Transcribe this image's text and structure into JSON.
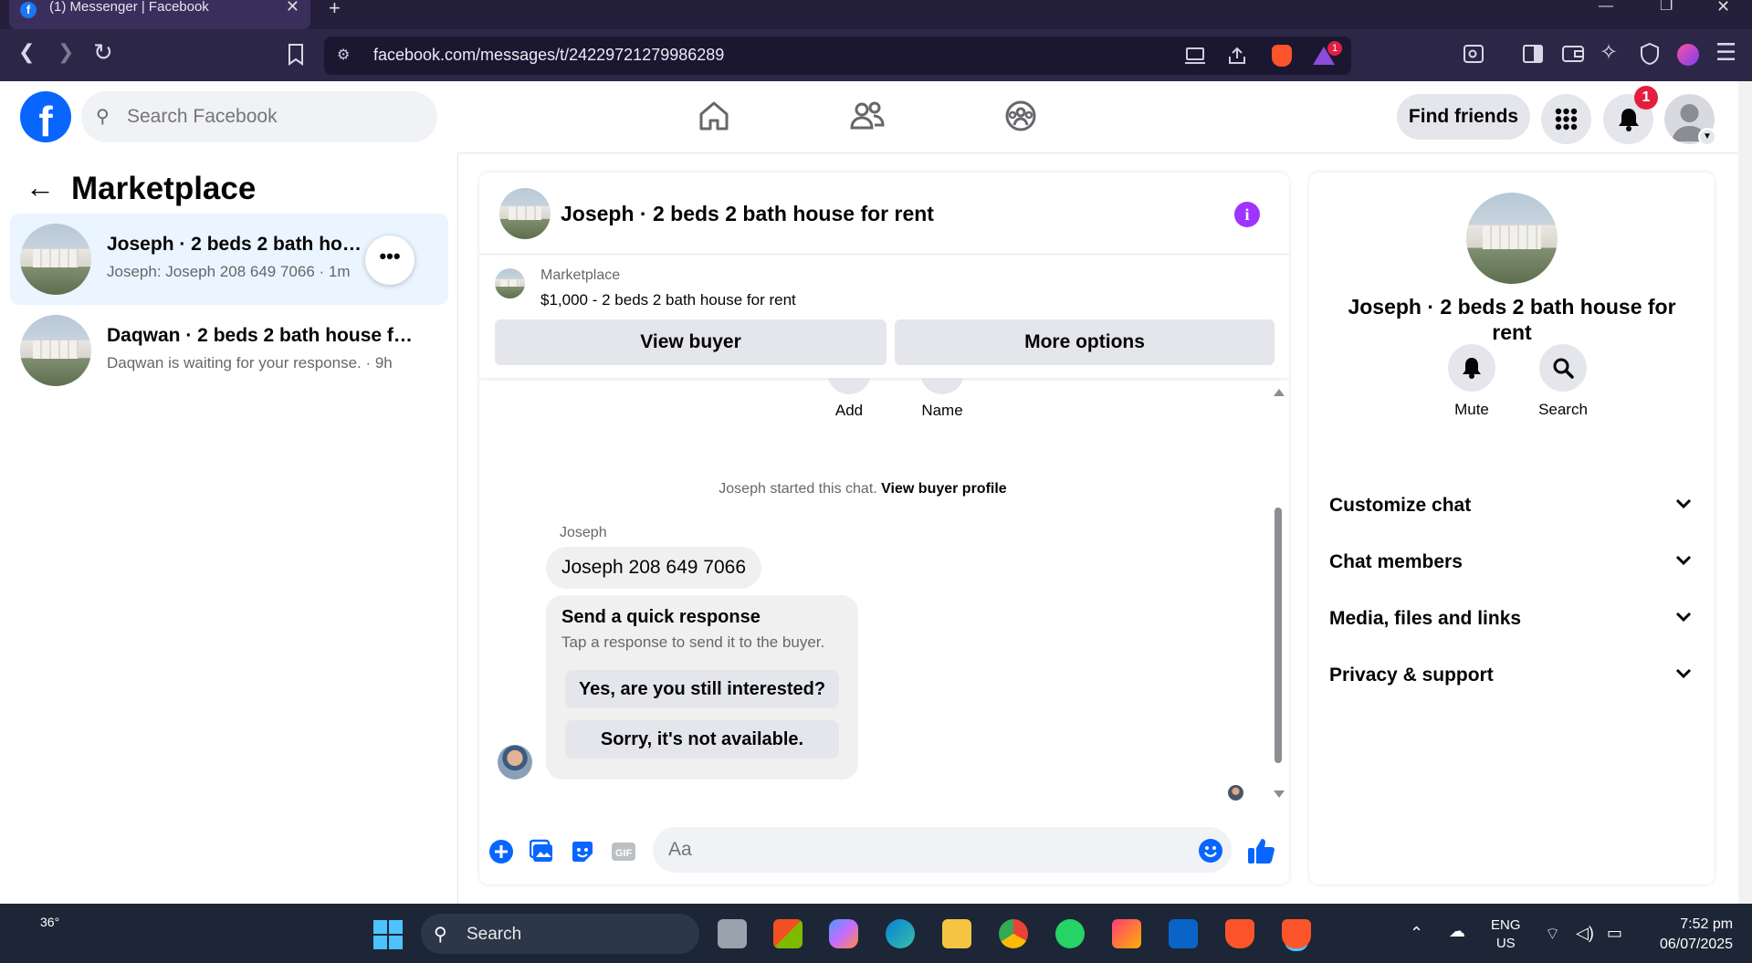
{
  "browser": {
    "tab_title": "(1) Messenger | Facebook",
    "url": "facebook.com/messages/t/24229721279986289",
    "brave_badge": "1"
  },
  "header": {
    "search_placeholder": "Search Facebook",
    "find_friends": "Find friends",
    "notification_count": "1",
    "logo_letter": "f"
  },
  "sidebar": {
    "title": "Marketplace",
    "conversations": [
      {
        "name": "Joseph · 2 beds 2 bath house for rent",
        "preview": "Joseph: Joseph 208 649 7066 · 1m"
      },
      {
        "name": "Daqwan · 2 beds 2 bath house for rent",
        "preview": "Daqwan is waiting for your response. · 9h"
      }
    ],
    "more_label": "•••"
  },
  "chat": {
    "title": "Joseph · 2 beds 2 bath house for rent",
    "marketplace_label": "Marketplace",
    "listing": "$1,000 - 2 beds 2 bath house for rent",
    "view_buyer": "View buyer",
    "more_options": "More options",
    "actions": {
      "add": "Add",
      "name": "Name"
    },
    "started_text": "Joseph started this chat.",
    "view_buyer_profile": "View buyer profile",
    "sender": "Joseph",
    "message": "Joseph 208 649 7066",
    "quick_title": "Send a quick response",
    "quick_sub": "Tap a response to send it to the buyer.",
    "quick_replies": [
      "Yes, are you still interested?",
      "Sorry, it's not available."
    ],
    "input_placeholder": "Aa"
  },
  "info_panel": {
    "title": "Joseph · 2 beds 2 bath house for rent",
    "mute": "Mute",
    "search": "Search",
    "sections": [
      "Customize chat",
      "Chat members",
      "Media, files and links",
      "Privacy & support"
    ]
  },
  "taskbar": {
    "weather": "36°",
    "search": "Search",
    "lang_top": "ENG",
    "lang_bottom": "US",
    "time": "7:52 pm",
    "date": "06/07/2025"
  },
  "colors": {
    "facebook_blue": "#0866ff",
    "info_purple": "#a033ff",
    "badge_red": "#e41e3f"
  }
}
